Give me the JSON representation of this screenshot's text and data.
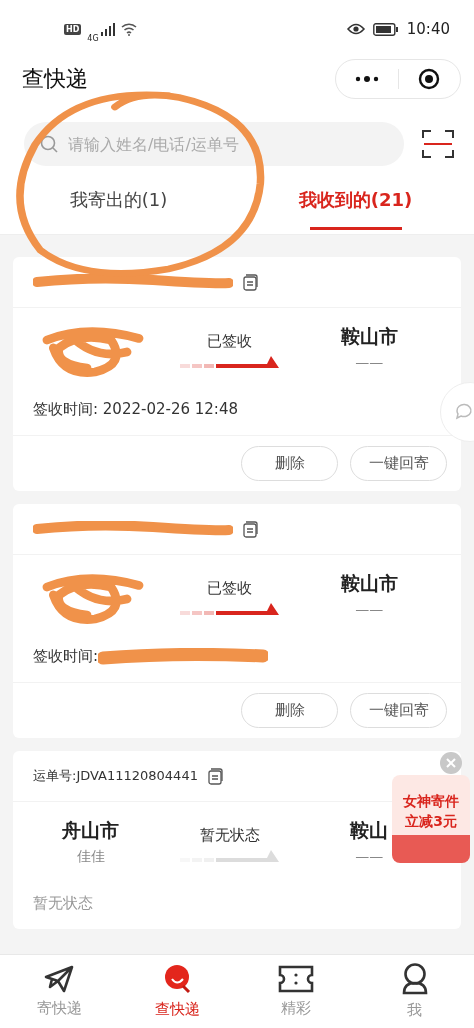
{
  "status_bar": {
    "hd": "HD",
    "network": "4G",
    "time": "10:40"
  },
  "header": {
    "title": "查快递"
  },
  "search": {
    "placeholder": "请输入姓名/电话/运单号"
  },
  "annotation": {
    "circle_scribble": true
  },
  "tabs": [
    {
      "label": "我寄出的(1)",
      "selected": false
    },
    {
      "label": "我收到的(21)",
      "selected": true
    }
  ],
  "cards": [
    {
      "waybill_redacted": true,
      "origin": {
        "redacted": true
      },
      "status": "已签收",
      "signed": true,
      "destination": {
        "city": "鞍山市",
        "name": "——"
      },
      "note": "签收时间: 2022-02-26 12:48",
      "buttons": [
        "删除",
        "一键回寄"
      ]
    },
    {
      "waybill_redacted": true,
      "origin": {
        "redacted": true
      },
      "status": "已签收",
      "signed": true,
      "destination": {
        "city": "鞍山市",
        "name": "——"
      },
      "note": "签收时间:",
      "note_redacted": true,
      "buttons": [
        "删除",
        "一键回寄"
      ]
    },
    {
      "waybill": "运单号:JDVA11120804441",
      "origin": {
        "city": "舟山市",
        "name": "佳佳"
      },
      "status": "暂无状态",
      "signed": false,
      "destination": {
        "city": "鞍山",
        "name": "——"
      },
      "note": "暂无状态"
    }
  ],
  "promo": {
    "line1": "女神寄件",
    "line2": "立减3元"
  },
  "bottom_nav": [
    {
      "label": "寄快递",
      "selected": false
    },
    {
      "label": "查快递",
      "selected": true
    },
    {
      "label": "精彩",
      "selected": false
    },
    {
      "label": "我",
      "selected": false
    }
  ]
}
